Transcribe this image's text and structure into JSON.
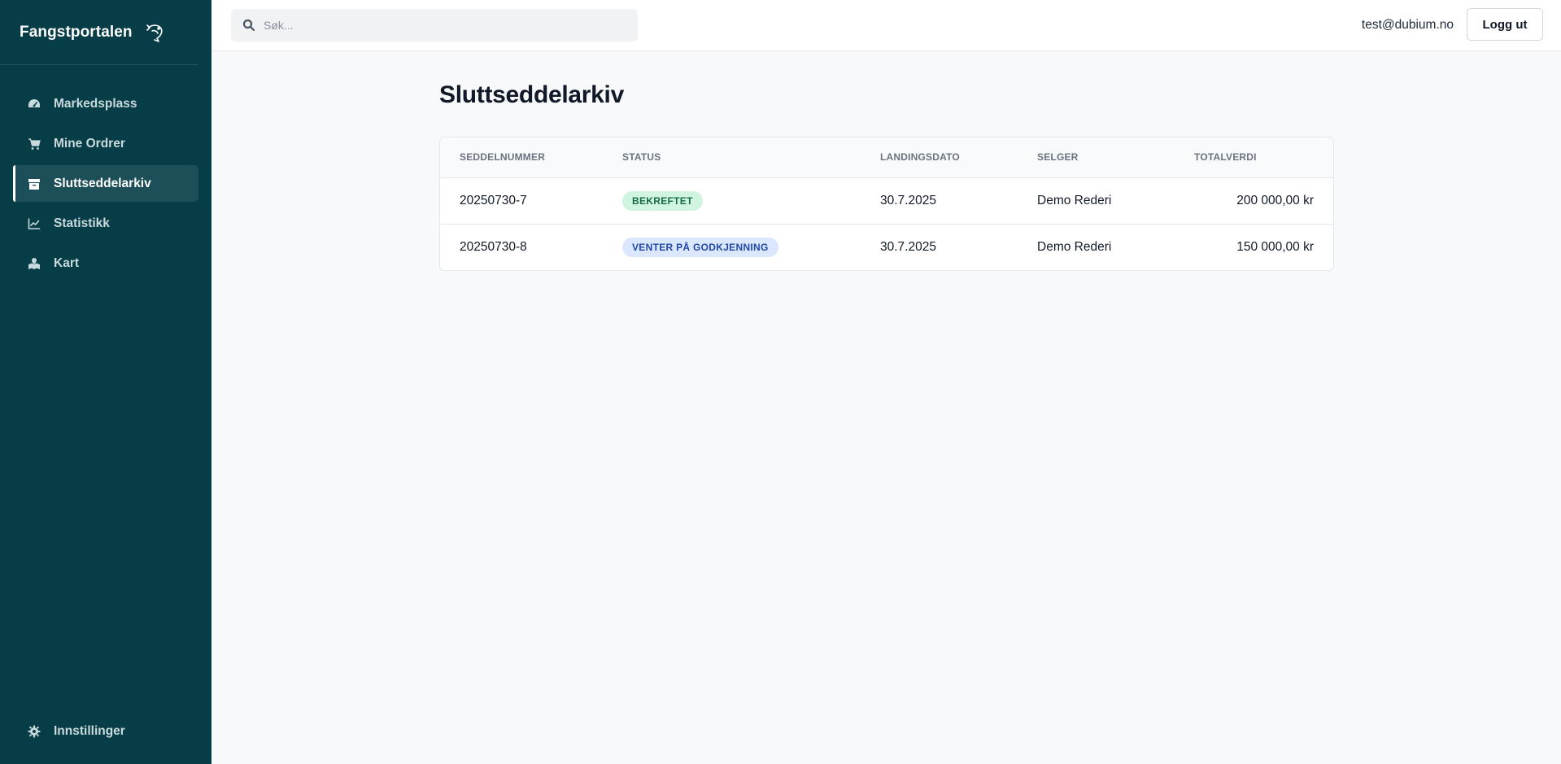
{
  "app": {
    "title": "Fangstportalen",
    "logo_icon": "fish-icon"
  },
  "sidebar": {
    "items": [
      {
        "label": "Markedsplass",
        "icon": "dashboard-gauge-icon",
        "active": false
      },
      {
        "label": "Mine Ordrer",
        "icon": "shopping-cart-icon",
        "active": false
      },
      {
        "label": "Sluttseddelarkiv",
        "icon": "archive-box-icon",
        "active": true
      },
      {
        "label": "Statistikk",
        "icon": "line-chart-icon",
        "active": false
      },
      {
        "label": "Kart",
        "icon": "map-icon",
        "active": false
      }
    ],
    "settings": {
      "label": "Innstillinger",
      "icon": "gear-icon"
    }
  },
  "header": {
    "search_placeholder": "Søk...",
    "user_email": "test@dubium.no",
    "logout_label": "Logg ut"
  },
  "main": {
    "title": "Sluttseddelarkiv",
    "table": {
      "columns": [
        "SEDDELNUMMER",
        "STATUS",
        "LANDINGSDATO",
        "SELGER",
        "TOTALVERDI"
      ],
      "rows": [
        {
          "number": "20250730-7",
          "status": "BEKREFTET",
          "status_color": "#d1f4e0",
          "date": "30.7.2025",
          "seller": "Demo Rederi",
          "total": "200 000,00 kr"
        },
        {
          "number": "20250730-8",
          "status": "VENTER PÅ GODKJENNING",
          "status_color": "#dbe7fd",
          "date": "30.7.2025",
          "seller": "Demo Rederi",
          "total": "150 000,00 kr"
        }
      ]
    }
  },
  "colors": {
    "sidebar_bg": "#073d47",
    "sidebar_active": "#1d4f58",
    "page_bg": "#f8f9fb"
  }
}
